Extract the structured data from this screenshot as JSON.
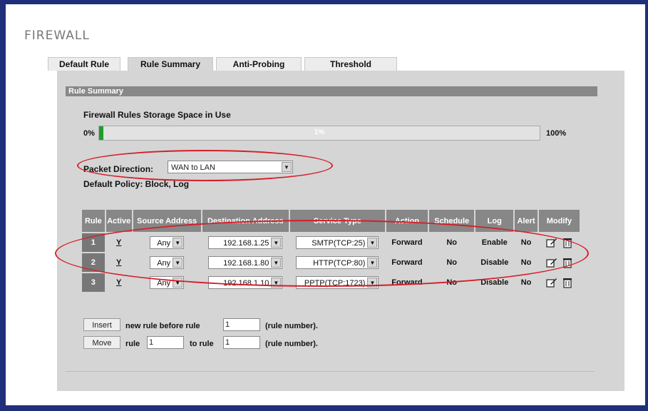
{
  "page": {
    "title": "FIREWALL"
  },
  "tabs": [
    {
      "label": "Default Rule"
    },
    {
      "label": "Rule Summary"
    },
    {
      "label": "Anti-Probing"
    },
    {
      "label": "Threshold"
    }
  ],
  "section": {
    "title": "Rule Summary"
  },
  "storage": {
    "label": "Firewall Rules Storage Space in Use",
    "min_label": "0%",
    "max_label": "100%",
    "value_text": "1%",
    "value_fraction": 0.01
  },
  "packet_direction": {
    "label": "Packet Direction:",
    "value": "WAN to LAN"
  },
  "default_policy": {
    "text": "Default Policy: Block, Log"
  },
  "table": {
    "headers": {
      "rule": "Rule",
      "active": "Active",
      "source": "Source Address",
      "destination": "Destination Address",
      "service": "Service Type",
      "action": "Action",
      "schedule": "Schedule",
      "log": "Log",
      "alert": "Alert",
      "modify": "Modify"
    },
    "rows": [
      {
        "num": "1",
        "active": "Y",
        "source": "Any",
        "destination": "192.168.1.25",
        "service": "SMTP(TCP:25)",
        "action": "Forward",
        "schedule": "No",
        "log": "Enable",
        "alert": "No"
      },
      {
        "num": "2",
        "active": "Y",
        "source": "Any",
        "destination": "192.168.1.80",
        "service": "HTTP(TCP:80)",
        "action": "Forward",
        "schedule": "No",
        "log": "Disable",
        "alert": "No"
      },
      {
        "num": "3",
        "active": "Y",
        "source": "Any",
        "destination": "192.168.1.10",
        "service": "PPTP(TCP:1723)",
        "action": "Forward",
        "schedule": "No",
        "log": "Disable",
        "alert": "No"
      }
    ]
  },
  "insert": {
    "button": "Insert",
    "text": "new rule before rule",
    "value": "1",
    "suffix": "(rule number)."
  },
  "move": {
    "button": "Move",
    "rule_label": "rule",
    "from_value": "1",
    "to_label": "to rule",
    "to_value": "1",
    "suffix": "(rule number)."
  },
  "colors": {
    "annotation": "#d41f2a",
    "progress": "#1f9e2d",
    "header": "#878787"
  }
}
